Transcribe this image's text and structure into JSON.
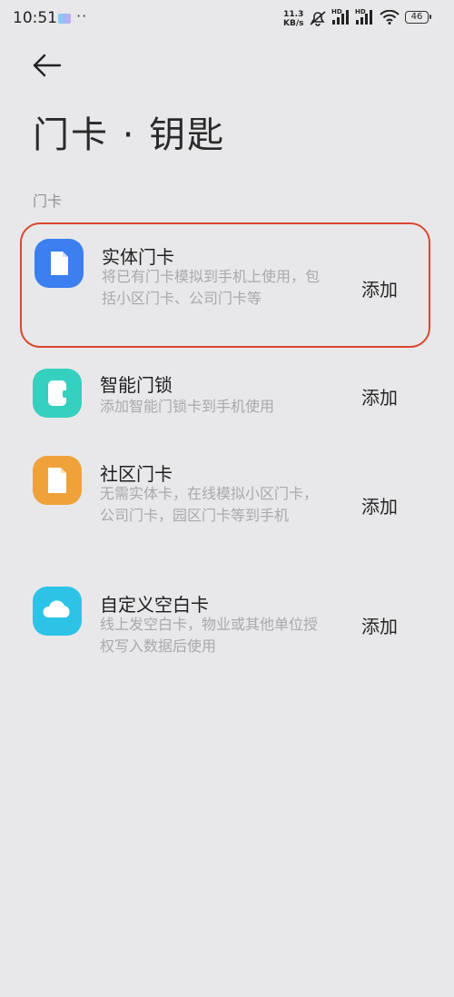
{
  "status_bar": {
    "time": "10:51",
    "dots": "··",
    "net_speed_value": "11.3",
    "net_speed_unit": "KB/s",
    "hd_label": "HD",
    "battery": "46"
  },
  "header": {
    "back_icon": "arrow-left-icon",
    "title": "门卡 · 钥匙"
  },
  "section_label": "门卡",
  "cards": [
    {
      "title": "实体门卡",
      "desc": "将已有门卡模拟到手机上使用，包括小区门卡、公司门卡等",
      "action": "添加",
      "icon": "card-icon",
      "color": "#3b7ff0"
    },
    {
      "title": "智能门锁",
      "desc": "添加智能门锁卡到手机使用",
      "action": "添加",
      "icon": "lock-icon",
      "color": "#35d0bf"
    },
    {
      "title": "社区门卡",
      "desc": "无需实体卡，在线模拟小区门卡，公司门卡，园区门卡等到手机",
      "action": "添加",
      "icon": "community-card-icon",
      "color": "#f0a23a"
    },
    {
      "title": "自定义空白卡",
      "desc": "线上发空白卡，物业或其他单位授权写入数据后使用",
      "action": "添加",
      "icon": "cloud-icon",
      "color": "#2dc3e6"
    }
  ],
  "highlight_color": "#d9482f"
}
